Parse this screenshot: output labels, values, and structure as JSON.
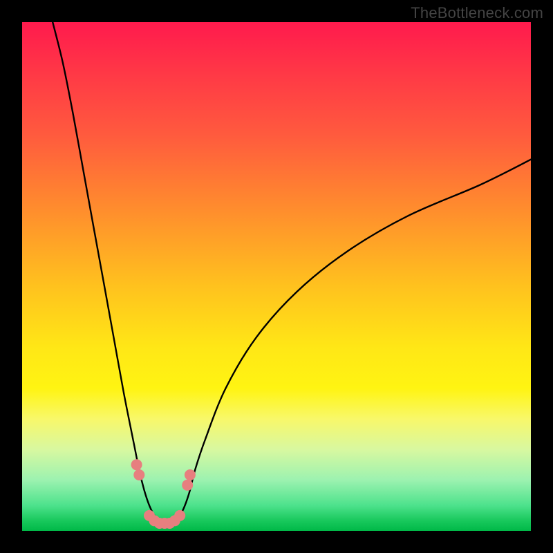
{
  "watermark": "TheBottleneck.com",
  "chart_data": {
    "type": "line",
    "title": "",
    "xlabel": "",
    "ylabel": "",
    "xlim": [
      0,
      100
    ],
    "ylim": [
      0,
      100
    ],
    "series": [
      {
        "name": "bottleneck-curve",
        "x": [
          6,
          8,
          10,
          12,
          14,
          16,
          18,
          20,
          22,
          23,
          24,
          25,
          26,
          27,
          28,
          29,
          30,
          31,
          32,
          33,
          34,
          36,
          40,
          46,
          54,
          64,
          76,
          90,
          100
        ],
        "y": [
          100,
          92,
          82,
          71,
          60,
          49,
          38,
          27,
          17,
          12,
          8,
          5,
          3,
          2,
          1.5,
          1.5,
          2,
          3,
          5,
          8,
          12,
          18,
          28,
          38,
          47,
          55,
          62,
          68,
          73
        ]
      }
    ],
    "markers": {
      "name": "highlight-dots",
      "color": "#e77f7f",
      "points": [
        {
          "x": 22.5,
          "y": 13
        },
        {
          "x": 23.0,
          "y": 11
        },
        {
          "x": 25.0,
          "y": 3
        },
        {
          "x": 26.0,
          "y": 2
        },
        {
          "x": 27.0,
          "y": 1.5
        },
        {
          "x": 28.0,
          "y": 1.5
        },
        {
          "x": 29.0,
          "y": 1.5
        },
        {
          "x": 30.0,
          "y": 2
        },
        {
          "x": 31.0,
          "y": 3
        },
        {
          "x": 32.5,
          "y": 9
        },
        {
          "x": 33.0,
          "y": 11
        }
      ]
    },
    "gradient_stops": [
      {
        "pos": 0,
        "color": "#ff1a4d"
      },
      {
        "pos": 50,
        "color": "#ffe716"
      },
      {
        "pos": 100,
        "color": "#00b948"
      }
    ]
  }
}
